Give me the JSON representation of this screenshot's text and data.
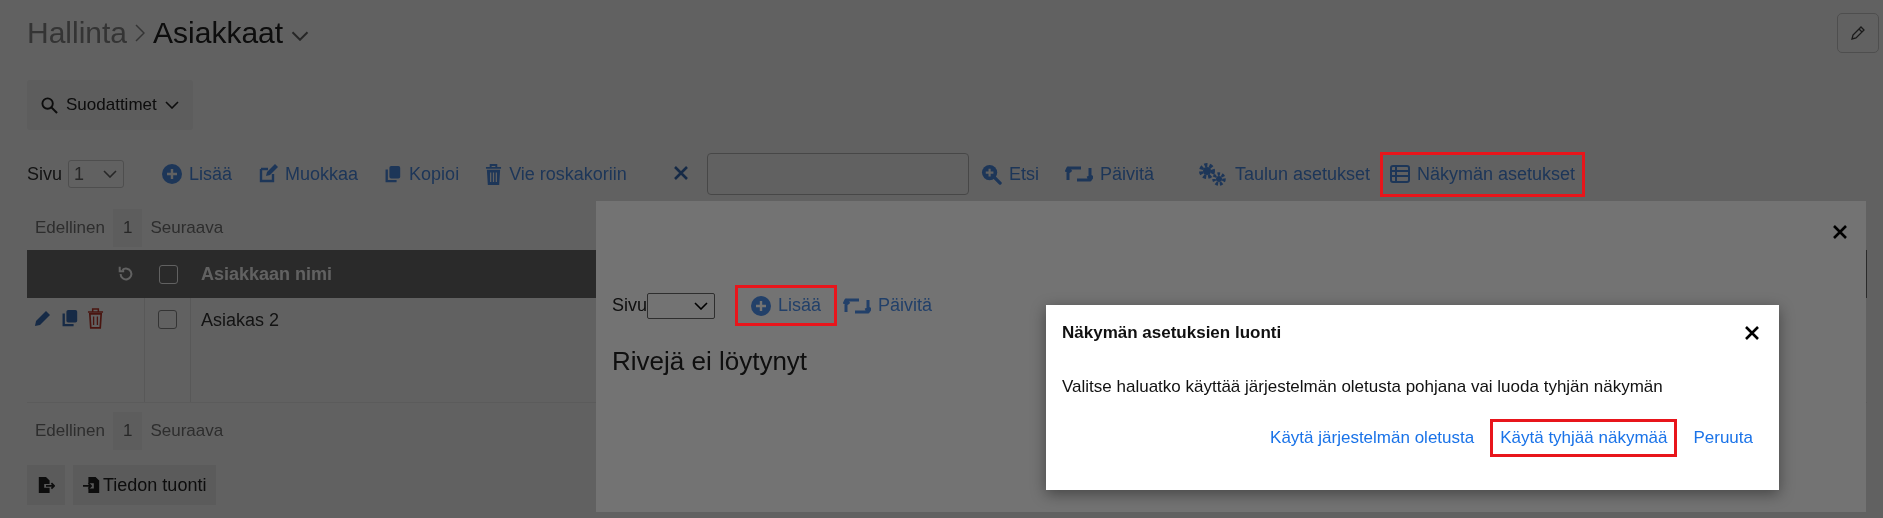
{
  "breadcrumb": [
    {
      "label": "Hallinta",
      "current": false
    },
    {
      "label": "Asiakkaat",
      "current": true
    }
  ],
  "filter_button": {
    "label": "Suodattimet"
  },
  "toolbar": {
    "page_label": "Sivu",
    "page_value": "1",
    "actions": [
      {
        "kind": "plus",
        "label": "Lisää",
        "highlighted": false
      },
      {
        "kind": "edit",
        "label": "Muokkaa",
        "highlighted": false
      },
      {
        "kind": "copy",
        "label": "Kopioi",
        "highlighted": false
      },
      {
        "kind": "trash",
        "label": "Vie roskakoriin",
        "highlighted": false
      }
    ],
    "search_actions": [
      {
        "kind": "search",
        "label": "Etsi",
        "highlighted": false
      },
      {
        "kind": "refresh",
        "label": "Päivitä",
        "highlighted": false
      }
    ],
    "settings_actions": [
      {
        "kind": "gears",
        "label": "Taulun asetukset",
        "highlighted": false
      },
      {
        "kind": "list",
        "label": "Näkymän asetukset",
        "highlighted": true
      }
    ]
  },
  "pager_top": {
    "previous": "Edellinen",
    "page": "1",
    "next": "Seuraava"
  },
  "table": {
    "select_all_checked": false,
    "columns": [
      "Asiakkaan nimi"
    ],
    "rows": [
      {
        "name": "Asiakas 2",
        "checked": false
      }
    ]
  },
  "pager_bottom": {
    "previous": "Edellinen",
    "page": "1",
    "next": "Seuraava"
  },
  "import_button": {
    "label": "Tiedon tuonti"
  },
  "panel": {
    "page_label": "Sivu",
    "actions": [
      {
        "kind": "plus",
        "label": "Lisää",
        "highlighted": true
      },
      {
        "kind": "refresh",
        "label": "Päivitä",
        "highlighted": false
      }
    ],
    "empty_text": "Rivejä ei löytynyt"
  },
  "dialog": {
    "title": "Näkymän asetuksien luonti",
    "message": "Valitse haluatko käyttää järjestelmän oletusta pohjana vai luoda tyhjän näkymän",
    "buttons": [
      {
        "label": "Käytä järjestelmän oletusta",
        "highlighted": false
      },
      {
        "label": "Käytä tyhjää näkymää",
        "highlighted": true
      },
      {
        "label": "Peruuta",
        "highlighted": false
      }
    ]
  }
}
